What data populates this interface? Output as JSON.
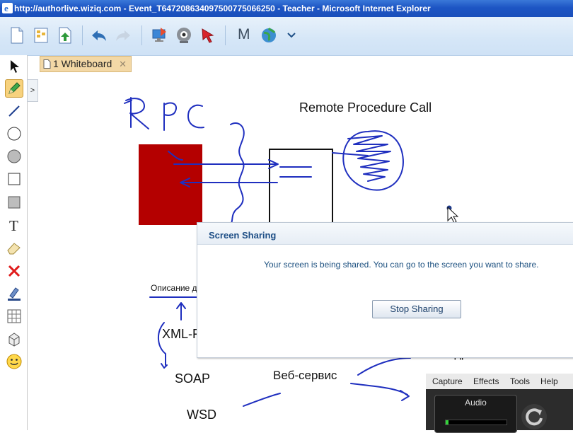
{
  "window": {
    "title": "http://authorlive.wiziq.com - Event_T647208634097500775066250 - Teacher - Microsoft Internet Explorer"
  },
  "toolbar": {
    "buttons": [
      "new-page-icon",
      "pages-icon",
      "upload-icon",
      "undo-icon",
      "redo-icon",
      "share-screen-icon",
      "webcam-icon",
      "pointer-icon",
      "m-icon",
      "globe-icon",
      "more-icon"
    ],
    "m_label": "M"
  },
  "whiteboard": {
    "tab_label": "1 Whiteboard",
    "close_glyph": "✕",
    "expander_glyph": ">"
  },
  "canvas": {
    "heading": "Remote Procedure Call",
    "label_description": "Описание д",
    "label_xml": "XML-F",
    "label_soap": "SOAP",
    "label_webservice": "Веб-сервис",
    "label_wsd": "WSD",
    "label_url": "URL - адрес",
    "colors": {
      "ink": "#1f2fbf",
      "red_box": "#b40000"
    }
  },
  "dialog": {
    "title": "Screen Sharing",
    "message": "Your screen is being shared. You can go to the screen you want to share.",
    "stop_button": "Stop Sharing"
  },
  "capture_panel": {
    "menu": [
      "Capture",
      "Effects",
      "Tools",
      "Help"
    ],
    "audio_label": "Audio",
    "meter_level": 0.05
  },
  "left_tools": [
    "select-arrow-icon",
    "pencil-icon",
    "line-icon",
    "circle-icon",
    "filled-circle-icon",
    "rectangle-icon",
    "filled-rectangle-icon",
    "text-tool-icon",
    "eraser-icon",
    "delete-icon",
    "highlighter-icon",
    "table-icon",
    "cube-icon",
    "smiley-icon"
  ]
}
